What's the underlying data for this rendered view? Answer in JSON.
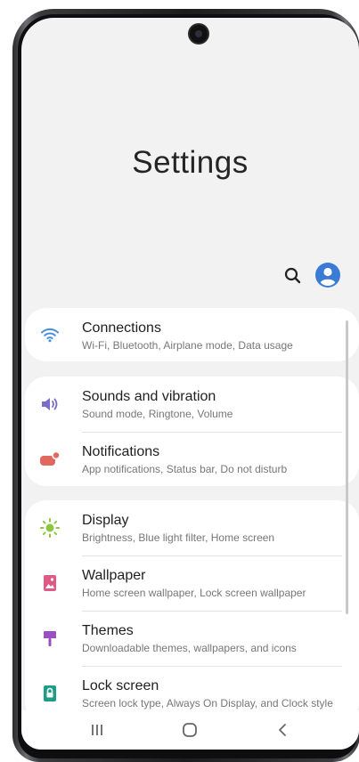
{
  "header": {
    "title": "Settings"
  },
  "toolbar": {
    "search_icon": "search-icon",
    "profile_icon": "account-icon"
  },
  "colors": {
    "background": "#f2f2f2",
    "card": "#ffffff",
    "connections_icon": "#4a90d9",
    "sounds_icon": "#7a6cc4",
    "notifications_icon": "#e0685c",
    "display_icon": "#8cc63f",
    "wallpaper_icon": "#e05a86",
    "themes_icon": "#9b4fc4",
    "lockscreen_icon": "#1f9e87",
    "profile": "#3a7bd5"
  },
  "groups": [
    {
      "items": [
        {
          "icon": "wifi-icon",
          "title": "Connections",
          "subtitle": "Wi-Fi, Bluetooth, Airplane mode, Data usage"
        }
      ]
    },
    {
      "items": [
        {
          "icon": "speaker-icon",
          "title": "Sounds and vibration",
          "subtitle": "Sound mode, Ringtone, Volume"
        },
        {
          "icon": "notification-icon",
          "title": "Notifications",
          "subtitle": "App notifications, Status bar, Do not disturb"
        }
      ]
    },
    {
      "items": [
        {
          "icon": "brightness-icon",
          "title": "Display",
          "subtitle": "Brightness, Blue light filter, Home screen"
        },
        {
          "icon": "wallpaper-icon",
          "title": "Wallpaper",
          "subtitle": "Home screen wallpaper, Lock screen wallpaper"
        },
        {
          "icon": "themes-icon",
          "title": "Themes",
          "subtitle": "Downloadable themes, wallpapers, and icons"
        },
        {
          "icon": "lock-icon",
          "title": "Lock screen",
          "subtitle": "Screen lock type, Always On Display, and Clock style"
        }
      ]
    }
  ],
  "navbar": {
    "recents_icon": "recents-icon",
    "home_icon": "home-icon",
    "back_icon": "back-icon"
  }
}
